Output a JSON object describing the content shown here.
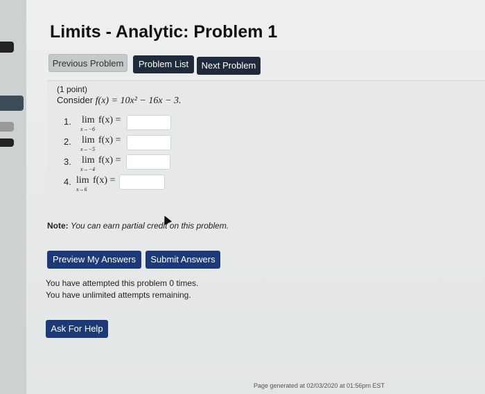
{
  "header": {
    "title": "Limits - Analytic: Problem 1"
  },
  "nav": {
    "previous_label": "Previous Problem",
    "list_label": "Problem List",
    "next_label": "Next Problem"
  },
  "problem": {
    "points": "(1 point)",
    "consider_prefix": "Consider ",
    "function": "f(x) = 10x² − 16x − 3.",
    "items": [
      {
        "num": "1.",
        "lim": "lim",
        "sub": "x→−6",
        "fx": "f(x) =",
        "value": ""
      },
      {
        "num": "2.",
        "lim": "lim",
        "sub": "x→−5",
        "fx": "f(x) =",
        "value": ""
      },
      {
        "num": "3.",
        "lim": "lim",
        "sub": "x→−4",
        "fx": "f(x) =",
        "value": ""
      },
      {
        "num": "4.",
        "lim": "lim",
        "sub": "x→6",
        "fx": "f(x) =",
        "value": ""
      }
    ],
    "note_label": "Note:",
    "note_text": "You can earn partial credit on this problem."
  },
  "actions": {
    "preview_label": "Preview My Answers",
    "submit_label": "Submit Answers",
    "help_label": "Ask For Help"
  },
  "status": {
    "attempted": "You have attempted this problem 0 times.",
    "remaining": "You have unlimited attempts remaining."
  },
  "footer": {
    "generated": "Page generated at 02/03/2020 at 01:56pm EST"
  },
  "colors": {
    "nav_dark": "#1f2a3a",
    "action_navy": "#1d3a78",
    "answer_border": "#c9d8d0"
  }
}
